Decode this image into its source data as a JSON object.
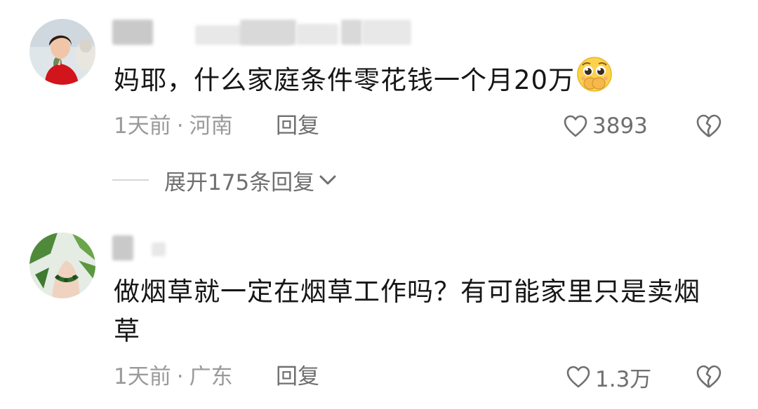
{
  "comments": [
    {
      "text": "妈耶，什么家庭条件零花钱一个月20万",
      "emoji": "pleading-face-covering-mouth-emoji",
      "time": "1天前",
      "separator": "·",
      "location": "河南",
      "reply_label": "回复",
      "like_count": "3893",
      "expand_replies_label": "展开175条回复"
    },
    {
      "text_line1": "做烟草就一定在烟草工作吗？有可能家里只是卖烟",
      "text_line2": "草",
      "time": "1天前",
      "separator": "·",
      "location": "广东",
      "reply_label": "回复",
      "like_count": "1.3万"
    }
  ],
  "icons": {
    "like": "heart-outline-icon",
    "dislike": "broken-heart-outline-icon",
    "expand": "chevron-down-icon"
  },
  "colors": {
    "text_primary": "#161616",
    "text_secondary": "#9a9a9a",
    "text_action": "#6f6f6f"
  }
}
